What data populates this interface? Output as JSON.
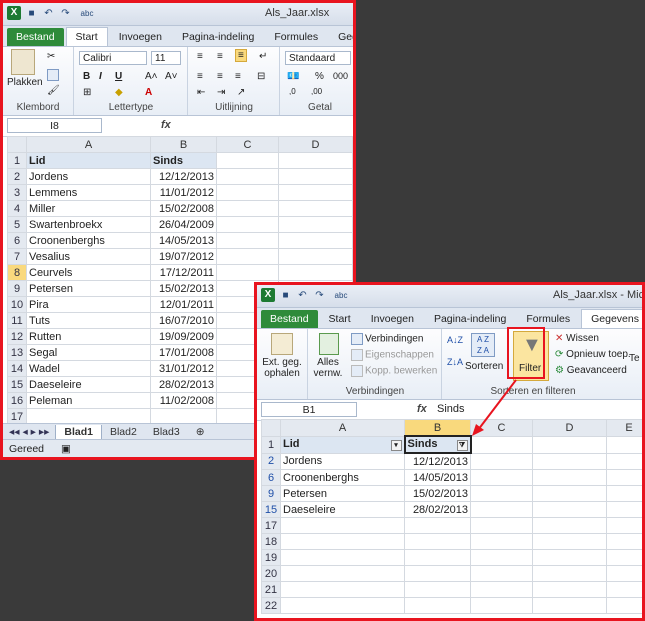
{
  "w1": {
    "title": "Als_Jaar.xlsx",
    "tabs": [
      "Bestand",
      "Start",
      "Invoegen",
      "Pagina-indeling",
      "Formules",
      "Gegevens"
    ],
    "ribbon": {
      "paste": "Plakken",
      "font": "Calibri",
      "size": "11",
      "numfmt": "Standaard",
      "groups": [
        "Klembord",
        "Lettertype",
        "Uitlijning",
        "Getal"
      ]
    },
    "namebox": "I8",
    "fx": "fx",
    "cols": [
      "A",
      "B",
      "C",
      "D"
    ],
    "rows": [
      {
        "n": "1",
        "a": "Lid",
        "b": "Sinds",
        "hdr": true
      },
      {
        "n": "2",
        "a": "Jordens",
        "b": "12/12/2013"
      },
      {
        "n": "3",
        "a": "Lemmens",
        "b": "11/01/2012"
      },
      {
        "n": "4",
        "a": "Miller",
        "b": "15/02/2008"
      },
      {
        "n": "5",
        "a": "Swartenbroekx",
        "b": "26/04/2009"
      },
      {
        "n": "6",
        "a": "Croonenberghs",
        "b": "14/05/2013"
      },
      {
        "n": "7",
        "a": "Vesalius",
        "b": "19/07/2012"
      },
      {
        "n": "8",
        "a": "Ceurvels",
        "b": "17/12/2011",
        "sel": true
      },
      {
        "n": "9",
        "a": "Petersen",
        "b": "15/02/2013"
      },
      {
        "n": "10",
        "a": "Pira",
        "b": "12/01/2011"
      },
      {
        "n": "11",
        "a": "Tuts",
        "b": "16/07/2010"
      },
      {
        "n": "12",
        "a": "Rutten",
        "b": "19/09/2009"
      },
      {
        "n": "13",
        "a": "Segal",
        "b": "17/01/2008"
      },
      {
        "n": "14",
        "a": "Wadel",
        "b": "31/01/2012"
      },
      {
        "n": "15",
        "a": "Daeseleire",
        "b": "28/02/2013"
      },
      {
        "n": "16",
        "a": "Peleman",
        "b": "11/02/2008"
      },
      {
        "n": "17",
        "a": "",
        "b": ""
      }
    ],
    "sheets": [
      "Blad1",
      "Blad2",
      "Blad3"
    ],
    "status": "Gereed"
  },
  "w2": {
    "title": "Als_Jaar.xlsx - Micros",
    "tabs": [
      "Bestand",
      "Start",
      "Invoegen",
      "Pagina-indeling",
      "Formules",
      "Gegevens",
      "Co"
    ],
    "ribbon": {
      "ext": "Ext. geg. ophalen",
      "refresh": "Alles vernw.",
      "connections": "Verbindingen",
      "properties": "Eigenschappen",
      "editlinks": "Kopp. bewerken",
      "sort": "Sorteren",
      "filter": "Filter",
      "clear": "Wissen",
      "reapply": "Opnieuw toep.",
      "advanced": "Geavanceerd",
      "more": "Te ko",
      "groups": [
        "Verbindingen",
        "Sorteren en filteren"
      ]
    },
    "namebox": "B1",
    "fx": "fx",
    "fxvalue": "Sinds",
    "cols": [
      "A",
      "B",
      "C",
      "D",
      "E"
    ],
    "rows": [
      {
        "n": "1",
        "a": "Lid",
        "b": "Sinds",
        "hdr": true
      },
      {
        "n": "2",
        "a": "Jordens",
        "b": "12/12/2013",
        "filt": true
      },
      {
        "n": "6",
        "a": "Croonenberghs",
        "b": "14/05/2013",
        "filt": true
      },
      {
        "n": "9",
        "a": "Petersen",
        "b": "15/02/2013",
        "filt": true
      },
      {
        "n": "15",
        "a": "Daeseleire",
        "b": "28/02/2013",
        "filt": true
      },
      {
        "n": "17",
        "a": "",
        "b": ""
      },
      {
        "n": "18",
        "a": "",
        "b": ""
      },
      {
        "n": "19",
        "a": "",
        "b": ""
      },
      {
        "n": "20",
        "a": "",
        "b": ""
      },
      {
        "n": "21",
        "a": "",
        "b": ""
      },
      {
        "n": "22",
        "a": "",
        "b": ""
      }
    ]
  },
  "colors": {
    "frame": "#e8141f",
    "file_tab": "#2e8b3a",
    "selection": "#f9d97d",
    "row_filtered": "#1f4fa8"
  }
}
